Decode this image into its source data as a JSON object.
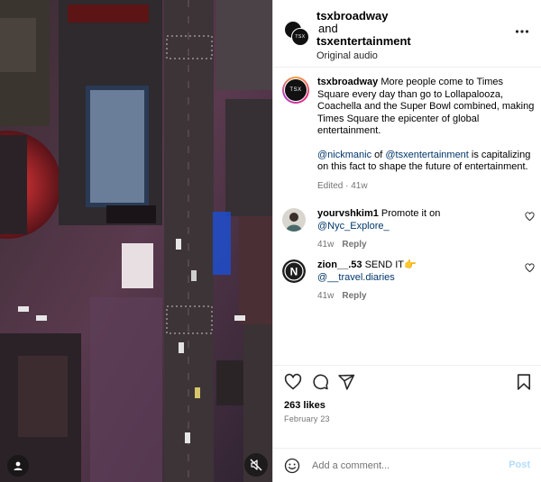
{
  "header": {
    "avatar_text": "TSX",
    "user1": "tsxbroadway",
    "joiner": "and",
    "user2": "tsxentertainment",
    "audio": "Original audio",
    "more_icon": "more-horizontal-icon"
  },
  "caption": {
    "avatar_text": "TSX",
    "username": "tsxbroadway",
    "paragraph1": "More people come to Times Square every day than go to Lollapalooza, Coachella and the Super Bowl combined, making Times Square the epicenter of global entertainment.",
    "mention1": "@nickmanic",
    "of_text": " of ",
    "mention2": "@tsxentertainment",
    "paragraph2_rest": " is capitalizing on this fact to shape the future of entertainment.",
    "meta": "Edited · 41w"
  },
  "comments": [
    {
      "username": "yourvshkim1",
      "text": " Promote it on ",
      "mention": "@Nyc_Explore_",
      "age": "41w",
      "reply_label": "Reply"
    },
    {
      "username": "zion__.53",
      "text": " SEND IT👉 ",
      "mention": "@__travel.diaries",
      "age": "41w",
      "reply_label": "Reply",
      "avatar_letter": "N"
    }
  ],
  "actions": {
    "likes": "263 likes",
    "date": "February 23",
    "icons": [
      "heart-icon",
      "comment-icon",
      "share-icon",
      "bookmark-icon"
    ]
  },
  "comment_box": {
    "placeholder": "Add a comment...",
    "post_label": "Post",
    "post_color": "#b3dbff"
  },
  "colors": {
    "link": "#00376b",
    "muted": "#737373",
    "border": "#dbdbdb"
  }
}
